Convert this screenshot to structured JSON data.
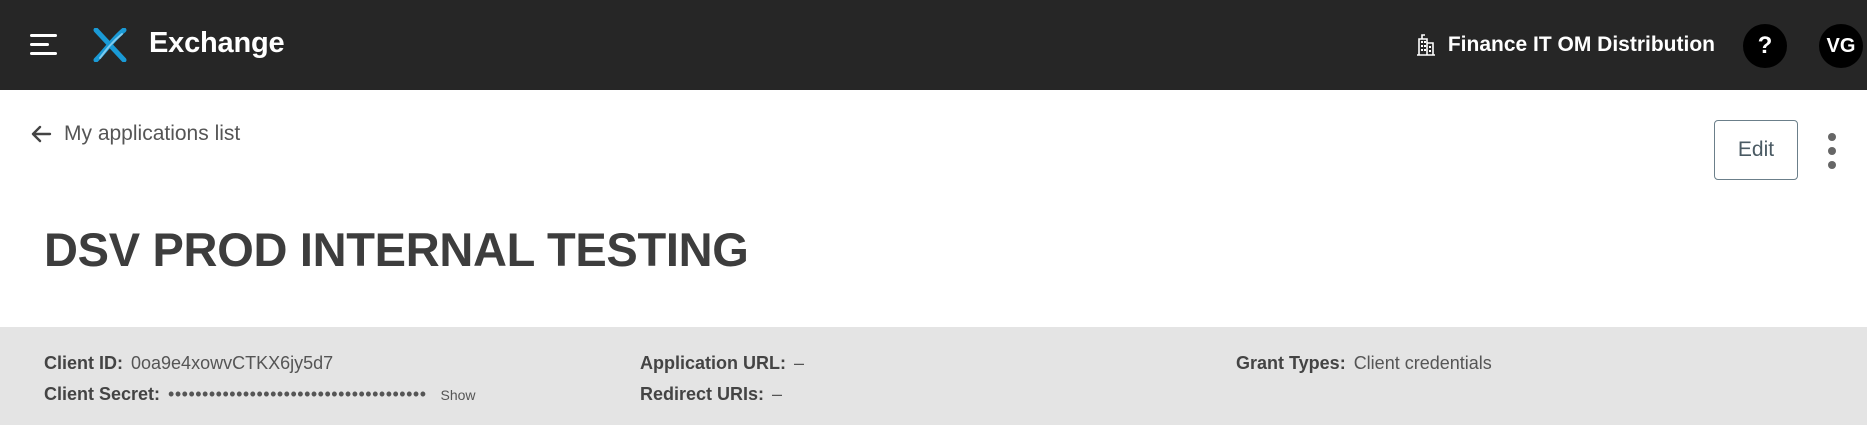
{
  "header": {
    "app_title": "Exchange",
    "org_name": "Finance IT OM Distribution",
    "help_label": "?",
    "user_initials": "VG",
    "icons": {
      "menu": "hamburger-menu-icon",
      "logo": "exchange-logo",
      "org": "building-icon"
    }
  },
  "nav": {
    "back_label": "My applications list",
    "back_icon": "arrow-left-icon"
  },
  "actions": {
    "edit_label": "Edit",
    "more_icon": "kebab-menu-icon"
  },
  "page": {
    "title": "DSV PROD INTERNAL TESTING"
  },
  "details": {
    "client_id_label": "Client ID:",
    "client_id_value": "0oa9e4xowvCTKX6jy5d7",
    "client_secret_label": "Client Secret:",
    "client_secret_value": "••••••••••••••••••••••••••••••••••••••",
    "show_label": "Show",
    "application_url_label": "Application URL:",
    "application_url_value": "–",
    "redirect_uris_label": "Redirect URIs:",
    "redirect_uris_value": "–",
    "grant_types_label": "Grant Types:",
    "grant_types_value": "Client credentials"
  },
  "colors": {
    "topbar": "#262626",
    "logo_accent": "#1a9ad6",
    "details_band": "#e4e4e4"
  }
}
